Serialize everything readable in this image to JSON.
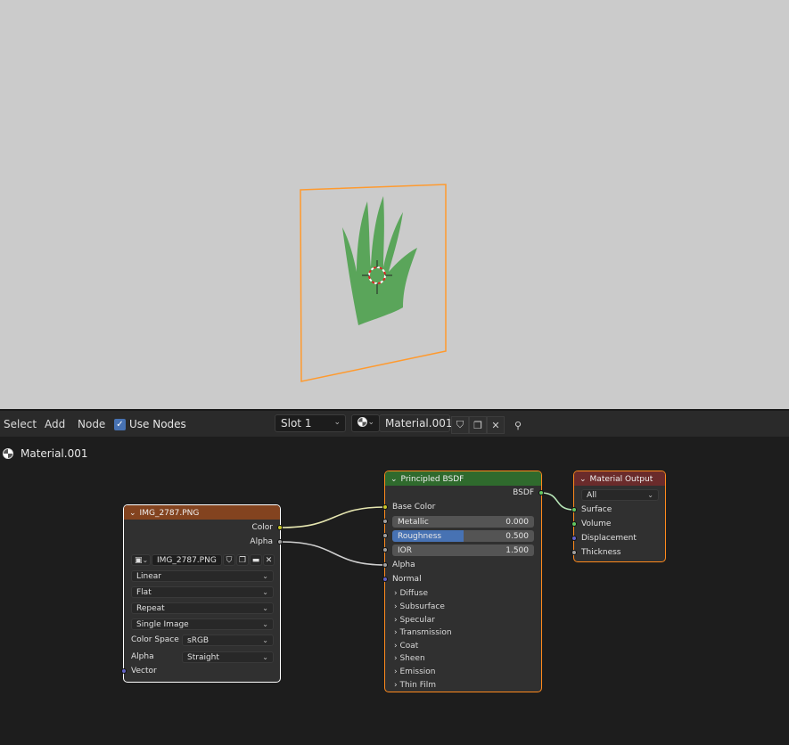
{
  "colors": {
    "viewport_bg": "#cbcbcb",
    "selection_outline": "#ff9a2e",
    "image_node_header": "#83431f",
    "bsdf_node_header": "#2f6a2d",
    "output_node_header": "#6a2b2b",
    "socket_color": "#c7c729",
    "socket_gray": "#a1a1a1",
    "socket_shader": "#63c763",
    "socket_vector": "#6363c7",
    "accent_blue": "#4772b3",
    "grass_green": "#5aa55a"
  },
  "header": {
    "menus": [
      "Select",
      "Add",
      "Node"
    ],
    "use_nodes_label": "Use Nodes",
    "use_nodes_checked": true,
    "slot": "Slot 1",
    "material_name": "Material.001"
  },
  "editor": {
    "material_label": "Material.001"
  },
  "image_node": {
    "title": "IMG_2787.PNG",
    "outputs": [
      "Color",
      "Alpha"
    ],
    "image_name": "IMG_2787.PNG",
    "interpolation": "Linear",
    "projection": "Flat",
    "extension": "Repeat",
    "source": "Single Image",
    "color_space_label": "Color Space",
    "color_space": "sRGB",
    "alpha_label": "Alpha",
    "alpha_mode": "Straight",
    "vector_label": "Vector"
  },
  "bsdf_node": {
    "title": "Principled BSDF",
    "output": "BSDF",
    "base_color": "Base Color",
    "metallic_label": "Metallic",
    "metallic": "0.000",
    "roughness_label": "Roughness",
    "roughness": "0.500",
    "roughness_fraction": 0.5,
    "ior_label": "IOR",
    "ior": "1.500",
    "alpha": "Alpha",
    "normal": "Normal",
    "panels": [
      "Diffuse",
      "Subsurface",
      "Specular",
      "Transmission",
      "Coat",
      "Sheen",
      "Emission",
      "Thin Film"
    ]
  },
  "output_node": {
    "title": "Material Output",
    "target": "All",
    "inputs": [
      "Surface",
      "Volume",
      "Displacement",
      "Thickness"
    ]
  }
}
